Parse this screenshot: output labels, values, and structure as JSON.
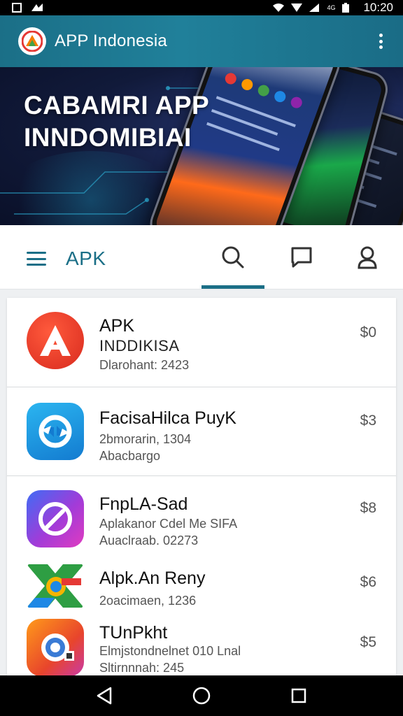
{
  "status_bar": {
    "time": "10:20",
    "network_label": "4G",
    "icons": [
      "screenshot-icon",
      "notification-icon",
      "wifi-icon",
      "signal-icon",
      "battery-icon"
    ]
  },
  "header": {
    "title": "APP Indonesia",
    "menu_icon": "more-vertical-icon"
  },
  "banner": {
    "line1": "CABAMRI APP",
    "line2": "INNDOMIBIAI"
  },
  "tabs": {
    "label": "APK",
    "icons": [
      "menu-icon",
      "search-icon",
      "chat-icon",
      "profile-icon"
    ],
    "active": "search"
  },
  "apps": [
    {
      "name": "APK",
      "subtitle": "INDDIKISA",
      "meta": "Dlarohant: 2423",
      "price": "$0",
      "icon": "letter-a-icon"
    },
    {
      "name": "FacisaHilca PuyK",
      "subtitle": "2bmorarin, 1304",
      "meta": "Abacbargo",
      "price": "$3",
      "icon": "arrows-icon"
    },
    {
      "name": "FnpLA-Sad",
      "subtitle": "Aplakanor Cdel Me SIFA",
      "meta": "Auaclraab. 02273",
      "price": "$8",
      "icon": "compass-icon"
    },
    {
      "name": "Alpk.An Reny",
      "subtitle": "2oacimaen, 1236",
      "meta": "",
      "price": "$6",
      "icon": "shapes-icon"
    },
    {
      "name": "TUnPkht",
      "subtitle": "Elmjstondnelnet 010 Lnal",
      "meta": "Sltirnnnah: 245",
      "price": "$5",
      "icon": "camera-icon"
    }
  ],
  "nav": {
    "icons": [
      "back-icon",
      "home-icon",
      "recents-icon"
    ]
  },
  "colors": {
    "primary": "#1b6f87",
    "banner_dark": "#111a3a"
  }
}
